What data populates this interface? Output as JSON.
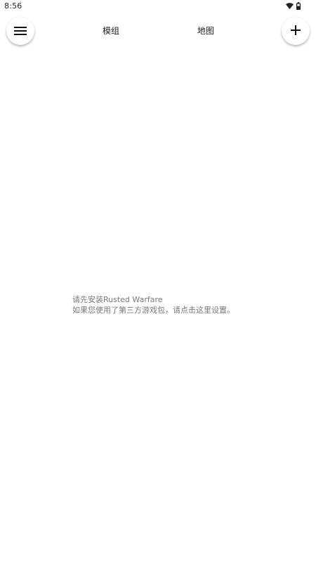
{
  "status_bar": {
    "time": "8:56",
    "icons": [
      "wifi-icon",
      "battery-icon"
    ]
  },
  "app_bar": {
    "menu_icon": "hamburger-menu-icon",
    "tabs": [
      {
        "label": "模组"
      },
      {
        "label": "地图"
      }
    ],
    "add_icon": "plus-icon"
  },
  "empty_state": {
    "line1": "请先安装Rusted Warfare",
    "line2": "如果您使用了第三方游戏包，请点击这里设置。"
  },
  "colors": {
    "background": "#ffffff",
    "message_text": "#7a7a7a"
  }
}
